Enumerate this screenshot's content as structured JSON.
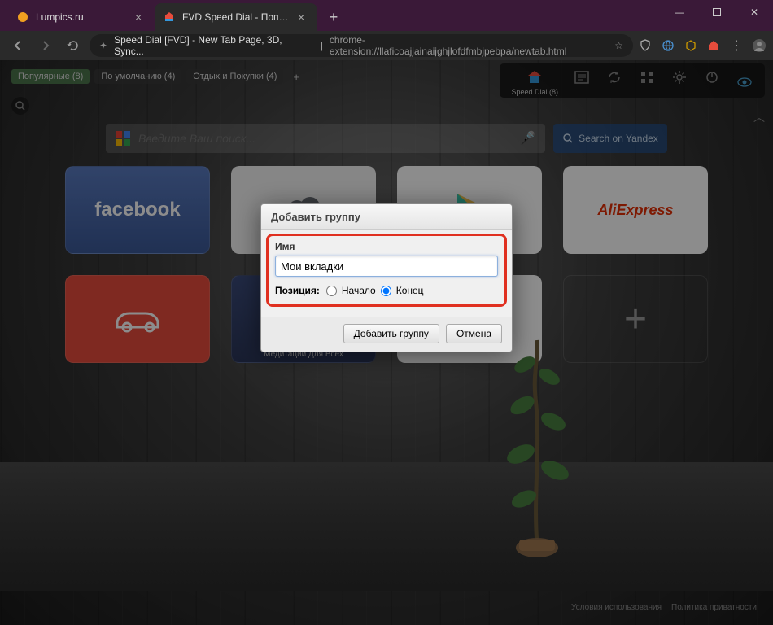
{
  "window": {
    "tabs": [
      {
        "title": "Lumpics.ru",
        "favicon_color": "#f0a020"
      },
      {
        "title": "FVD Speed Dial - Популярные",
        "favicon_house": true
      }
    ],
    "controls": {
      "min": "—",
      "max": "▢",
      "close": "✕"
    }
  },
  "addrbar": {
    "hint": "Speed Dial [FVD] - New Tab Page, 3D, Sync...",
    "url": "chrome-extension://llaficoajjainaijghjlofdfmbjpebpa/newtab.html"
  },
  "ext_icons": [
    "star",
    "shield",
    "globe",
    "cube",
    "house",
    "dots",
    "avatar"
  ],
  "groups": [
    {
      "label": "Популярные (8)",
      "active": true
    },
    {
      "label": "По умолчанию (4)",
      "active": false
    },
    {
      "label": "Отдых и Покупки (4)",
      "active": false
    }
  ],
  "toolbar": {
    "items": [
      {
        "icon": "house",
        "label": "Speed Dial (8)"
      },
      {
        "icon": "news",
        "label": ""
      },
      {
        "icon": "sync",
        "label": ""
      },
      {
        "icon": "grid",
        "label": ""
      },
      {
        "icon": "gear",
        "label": ""
      },
      {
        "icon": "power",
        "label": ""
      }
    ]
  },
  "search": {
    "placeholder": "Введите Ваш поиск...",
    "yandex_label": "Search on Yandex"
  },
  "tiles": {
    "row1": [
      {
        "kind": "fb",
        "text": "facebook"
      },
      {
        "kind": "cloud",
        "text": ""
      },
      {
        "kind": "gplay",
        "text": ""
      },
      {
        "kind": "ali",
        "text": "AliExpress"
      }
    ],
    "row2": [
      {
        "kind": "carr",
        "text": ""
      },
      {
        "kind": "medi",
        "label": "Медитации Для Всех"
      },
      {
        "kind": "bk",
        "text": ""
      },
      {
        "kind": "plus",
        "text": "+"
      }
    ]
  },
  "footer": {
    "terms": "Условия использования",
    "privacy": "Политика приватности"
  },
  "dialog": {
    "title": "Добавить группу",
    "name_label": "Имя",
    "name_value": "Мои вкладки",
    "position_label": "Позиция:",
    "opt_start": "Начало",
    "opt_end": "Конец",
    "submit": "Добавить группу",
    "cancel": "Отмена"
  }
}
